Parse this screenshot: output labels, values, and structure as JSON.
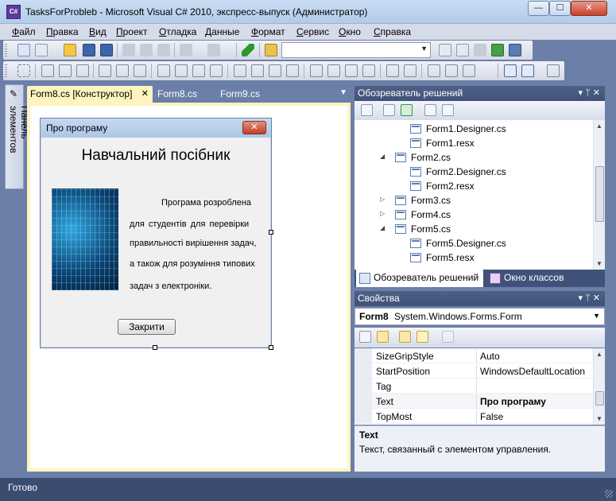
{
  "window": {
    "title": "TasksForProbleb - Microsoft Visual C# 2010, экспресс-выпуск (Администратор)",
    "app_icon": "C#",
    "minimize": "—",
    "maximize": "☐",
    "close": "✕"
  },
  "menu": [
    "Файл",
    "Правка",
    "Вид",
    "Проект",
    "Отладка",
    "Данные",
    "Формат",
    "Сервис",
    "Окно",
    "Справка"
  ],
  "toolbox": {
    "label": "Панель элементов",
    "pin": "✎"
  },
  "doc_tabs": {
    "active": "Form8.cs [Конструктор]",
    "active_close": "✕",
    "tab2": "Form8.cs",
    "tab3": "Form9.cs",
    "dropdown": "▼"
  },
  "form8": {
    "title": "Про програму",
    "close": "✕",
    "heading": "Навчальний посібник",
    "lines": [
      "Програма розроблена",
      "для   студентів  для  перевірки",
      "правильності вирішення задач,",
      "а також для розуміння типових",
      "задач з електроніки."
    ],
    "button": "Закрити"
  },
  "solution_explorer": {
    "title": "Обозреватель решений",
    "controls": "▾  ᛘ  ✕",
    "items": [
      {
        "label": "Form1.Designer.cs",
        "indent": 2
      },
      {
        "label": "Form1.resx",
        "indent": 2
      },
      {
        "label": "Form2.cs",
        "indent": 1,
        "expander": "◢"
      },
      {
        "label": "Form2.Designer.cs",
        "indent": 2
      },
      {
        "label": "Form2.resx",
        "indent": 2
      },
      {
        "label": "Form3.cs",
        "indent": 1,
        "expander": "▷"
      },
      {
        "label": "Form4.cs",
        "indent": 1,
        "expander": "▷"
      },
      {
        "label": "Form5.cs",
        "indent": 1,
        "expander": "◢"
      },
      {
        "label": "Form5.Designer.cs",
        "indent": 2
      },
      {
        "label": "Form5.resx",
        "indent": 2
      }
    ],
    "tab_active": "Обозреватель решений",
    "tab_inactive": "Окно классов"
  },
  "properties": {
    "title": "Свойства",
    "controls": "▾  ᛘ  ✕",
    "object_name": "Form8",
    "object_type": "System.Windows.Forms.Form",
    "rows": [
      {
        "name": "SizeGripStyle",
        "value": "Auto"
      },
      {
        "name": "StartPosition",
        "value": "WindowsDefaultLocation"
      },
      {
        "name": "Tag",
        "value": ""
      },
      {
        "name": "Text",
        "value": "Про програму",
        "bold": true
      },
      {
        "name": "TopMost",
        "value": "False"
      }
    ],
    "desc_title": "Text",
    "desc_text": "Текст, связанный с элементом управления."
  },
  "status": "Готово"
}
